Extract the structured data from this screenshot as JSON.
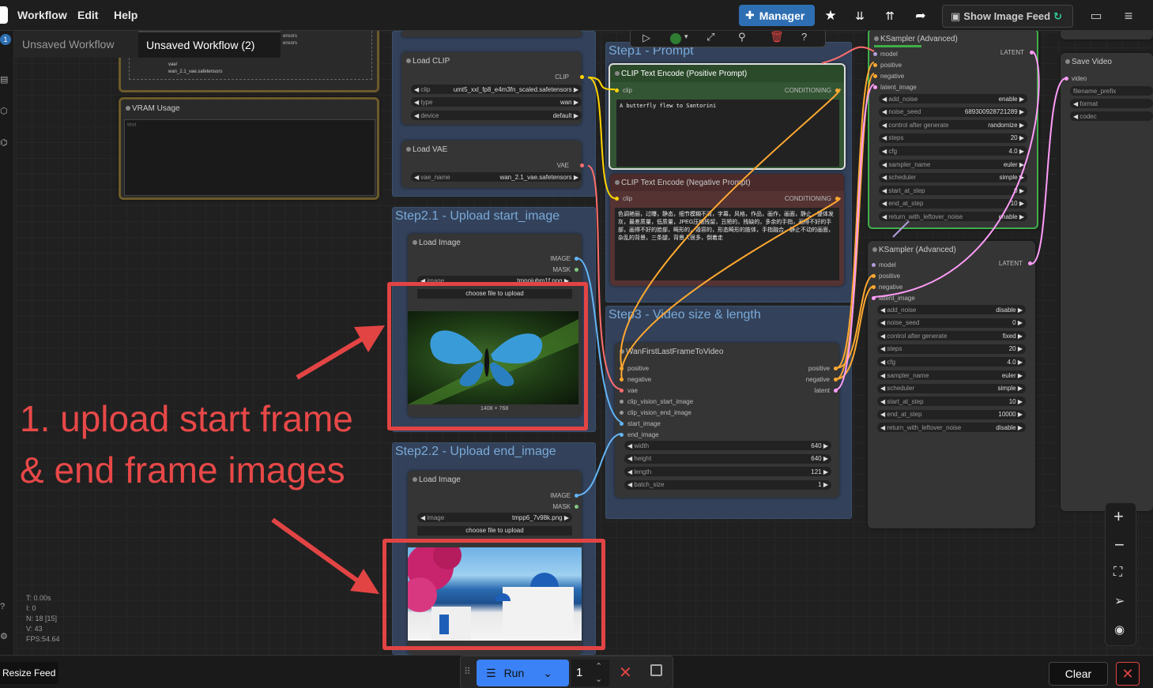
{
  "menu": {
    "items": [
      "Workflow",
      "Edit",
      "Help"
    ],
    "manager": "Manager",
    "show_image_feed": "Show Image Feed"
  },
  "tabs": [
    "Unsaved Workflow",
    "Unsaved Workflow (2)"
  ],
  "tab_badge": "1",
  "model_tree": {
    "lines": [
      "vae/",
      "wan_2.1_vae.safetensors"
    ],
    "frag1": "ensors",
    "frag2": "ensors"
  },
  "vram": {
    "title": "VRAM Usage",
    "placeholder": "text"
  },
  "load_clip": {
    "title": "Load CLIP",
    "out": "CLIP",
    "widgets": [
      {
        "n": "clip",
        "v": "umt5_xxl_fp8_e4m3fn_scaled.safetensors"
      },
      {
        "n": "type",
        "v": "wan"
      },
      {
        "n": "device",
        "v": "default"
      }
    ]
  },
  "load_vae": {
    "title": "Load VAE",
    "out": "VAE",
    "widgets": [
      {
        "n": "vae_name",
        "v": "wan_2.1_vae.safetensors"
      }
    ]
  },
  "groups": {
    "prompt": "Step1 - Prompt",
    "upload_start": "Step2.1 - Upload start_image",
    "upload_end": "Step2.2 - Upload end_image",
    "video": "Step3 - Video size & length"
  },
  "load_image1": {
    "title": "Load Image",
    "outs": [
      "IMAGE",
      "MASK"
    ],
    "widget": {
      "n": "image",
      "v": "tmpojubm1f.png"
    },
    "upload": "choose file to upload",
    "dims": "1408 × 768"
  },
  "load_image2": {
    "title": "Load Image",
    "outs": [
      "IMAGE",
      "MASK"
    ],
    "widget": {
      "n": "image",
      "v": "tmpp6_7v98k.png"
    },
    "upload": "choose file to upload"
  },
  "pos_prompt": {
    "title": "CLIP Text Encode (Positive Prompt)",
    "in": "clip",
    "out": "CONDITIONING",
    "text": "A butterfly flew to Santorini"
  },
  "neg_prompt": {
    "title": "CLIP Text Encode (Negative Prompt)",
    "in": "clip",
    "out": "CONDITIONING",
    "text": "色调艳丽，过曝，静态，细节模糊不清，字幕，风格，作品，画作，画面，静止，整体发灰，最差质量，低质量，JPEG压缩残留，丑陋的，残缺的，多余的手指，画得不好的手部，画得不好的脸部，畸形的，毁容的，形态畸形的肢体，手指融合，静止不动的画面，杂乱的背景，三条腿，背景人很多，倒着走"
  },
  "wan_node": {
    "title": "WanFirstLastFrameToVideo",
    "inputs": [
      "positive",
      "negative",
      "vae",
      "clip_vision_start_image",
      "clip_vision_end_image",
      "start_image",
      "end_image"
    ],
    "outputs": [
      "positive",
      "negative",
      "latent"
    ],
    "widgets": [
      {
        "n": "width",
        "v": "640"
      },
      {
        "n": "height",
        "v": "640"
      },
      {
        "n": "length",
        "v": "121"
      },
      {
        "n": "batch_size",
        "v": "1"
      }
    ]
  },
  "ksampler1": {
    "title": "KSampler (Advanced)",
    "inputs": [
      "model",
      "positive",
      "negative",
      "latent_image"
    ],
    "out": "LATENT",
    "widgets": [
      {
        "n": "add_noise",
        "v": "enable"
      },
      {
        "n": "noise_seed",
        "v": "689300928721289"
      },
      {
        "n": "control after generate",
        "v": "randomize"
      },
      {
        "n": "steps",
        "v": "20"
      },
      {
        "n": "cfg",
        "v": "4.0"
      },
      {
        "n": "sampler_name",
        "v": "euler"
      },
      {
        "n": "scheduler",
        "v": "simple"
      },
      {
        "n": "start_at_step",
        "v": "0"
      },
      {
        "n": "end_at_step",
        "v": "10"
      },
      {
        "n": "return_with_leftover_noise",
        "v": "enable"
      }
    ]
  },
  "ksampler2": {
    "title": "KSampler (Advanced)",
    "inputs": [
      "model",
      "positive",
      "negative",
      "latent_image"
    ],
    "out": "LATENT",
    "widgets": [
      {
        "n": "add_noise",
        "v": "disable"
      },
      {
        "n": "noise_seed",
        "v": "0"
      },
      {
        "n": "control after generate",
        "v": "fixed"
      },
      {
        "n": "steps",
        "v": "20"
      },
      {
        "n": "cfg",
        "v": "4.0"
      },
      {
        "n": "sampler_name",
        "v": "euler"
      },
      {
        "n": "scheduler",
        "v": "simple"
      },
      {
        "n": "start_at_step",
        "v": "10"
      },
      {
        "n": "end_at_step",
        "v": "10000"
      },
      {
        "n": "return_with_leftover_noise",
        "v": "disable"
      }
    ]
  },
  "save_video": {
    "title": "Save Video",
    "in": "video",
    "widgets": [
      "filename_prefix",
      "format",
      "codec"
    ]
  },
  "annotation": {
    "line1": "1. upload start frame",
    "line2": "& end frame images"
  },
  "stats": [
    "T: 0.00s",
    "I: 0",
    "N: 18 [15]",
    "V: 43",
    "FPS:54.64"
  ],
  "bottom": {
    "resize_feed": "Resize Feed",
    "run": "Run",
    "batch": "1",
    "clear": "Clear"
  },
  "colors": {
    "accent": "#2e6fb3",
    "annotation": "#e24444",
    "clip_link": "#ffd500",
    "vae_link": "#ff6e6e",
    "image_link": "#64b5f6",
    "latent_link": "#ff9cf9",
    "conditioning_link": "#ffa931",
    "model_link": "#b39ddb"
  }
}
